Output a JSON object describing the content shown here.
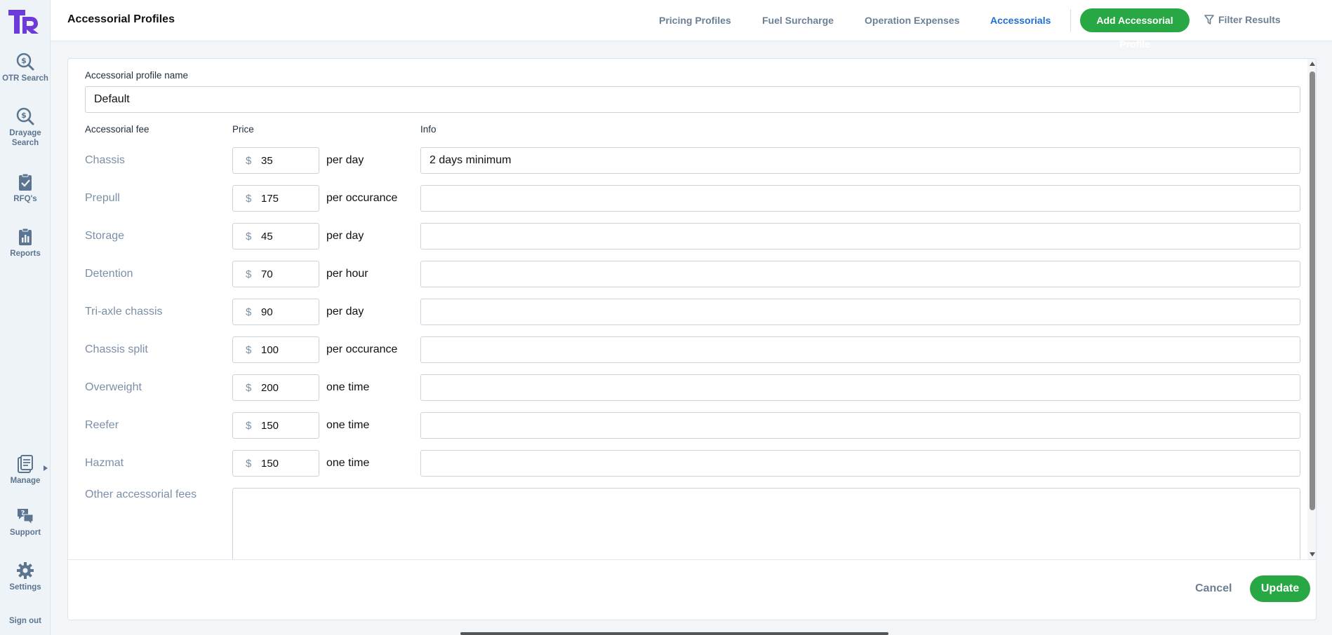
{
  "app": {
    "logo_text": "TR",
    "brand_color": "#6d3bd8",
    "accent_green": "#27a844",
    "active_tab_color": "#1f6fd1"
  },
  "sidebar": {
    "items": [
      {
        "label": "OTR Search",
        "icon": "search-dollar-icon"
      },
      {
        "label": "Drayage Search",
        "icon": "search-dollar-icon"
      },
      {
        "label": "RFQ's",
        "icon": "clipboard-check-icon"
      },
      {
        "label": "Reports",
        "icon": "clipboard-chart-icon"
      },
      {
        "label": "Manage",
        "icon": "document-icon"
      },
      {
        "label": "Support",
        "icon": "chat-help-icon"
      },
      {
        "label": "Settings",
        "icon": "gear-icon"
      }
    ],
    "sign_out": "Sign out"
  },
  "header": {
    "title": "Accessorial Profiles",
    "tabs": [
      {
        "label": "Pricing Profiles",
        "active": false
      },
      {
        "label": "Fuel Surcharge",
        "active": false
      },
      {
        "label": "Operation Expenses",
        "active": false
      },
      {
        "label": "Accessorials",
        "active": true
      }
    ],
    "add_button": "Add Accessorial Profile",
    "filter_label": "Filter Results"
  },
  "form": {
    "profile_name_label": "Accessorial profile name",
    "profile_name_value": "Default",
    "col_fee": "Accessorial fee",
    "col_price": "Price",
    "col_info": "Info",
    "currency": "$",
    "fees": [
      {
        "label": "Chassis",
        "price": "35",
        "unit": "per day",
        "info": "2 days minimum"
      },
      {
        "label": "Prepull",
        "price": "175",
        "unit": "per occurance",
        "info": ""
      },
      {
        "label": "Storage",
        "price": "45",
        "unit": "per day",
        "info": ""
      },
      {
        "label": "Detention",
        "price": "70",
        "unit": "per hour",
        "info": ""
      },
      {
        "label": "Tri-axle chassis",
        "price": "90",
        "unit": "per day",
        "info": ""
      },
      {
        "label": "Chassis split",
        "price": "100",
        "unit": "per occurance",
        "info": ""
      },
      {
        "label": "Overweight",
        "price": "200",
        "unit": "one time",
        "info": ""
      },
      {
        "label": "Reefer",
        "price": "150",
        "unit": "one time",
        "info": ""
      },
      {
        "label": "Hazmat",
        "price": "150",
        "unit": "one time",
        "info": ""
      }
    ],
    "other_label": "Other accessorial fees",
    "other_value": "",
    "cancel": "Cancel",
    "update": "Update"
  }
}
